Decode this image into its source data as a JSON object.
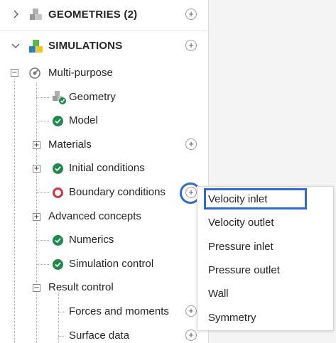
{
  "tree": {
    "geometries": {
      "label": "GEOMETRIES (2)",
      "icon": "cubes-gray-icon"
    },
    "simulations": {
      "label": "SIMULATIONS",
      "icon": "cubes-color-icon"
    },
    "multi_purpose": {
      "label": "Multi-purpose",
      "icon": "gauge-icon"
    },
    "geometry": {
      "label": "Geometry"
    },
    "model": {
      "label": "Model"
    },
    "materials": {
      "label": "Materials"
    },
    "initial_conditions": {
      "label": "Initial conditions"
    },
    "boundary_conditions": {
      "label": "Boundary conditions"
    },
    "advanced_concepts": {
      "label": "Advanced concepts"
    },
    "numerics": {
      "label": "Numerics"
    },
    "simulation_control": {
      "label": "Simulation control"
    },
    "result_control": {
      "label": "Result control"
    },
    "forces_and_moments": {
      "label": "Forces and moments"
    },
    "surface_data": {
      "label": "Surface data"
    }
  },
  "context_menu": {
    "items": [
      "Velocity inlet",
      "Velocity outlet",
      "Pressure inlet",
      "Pressure outlet",
      "Wall",
      "Symmetry"
    ],
    "selected": "Velocity inlet"
  },
  "glyphs": {
    "plus": "+",
    "minus": "−"
  },
  "colors": {
    "check_green": "#1e8a4c",
    "error_red": "#d9333f",
    "highlight_blue": "#2f6ad1"
  }
}
